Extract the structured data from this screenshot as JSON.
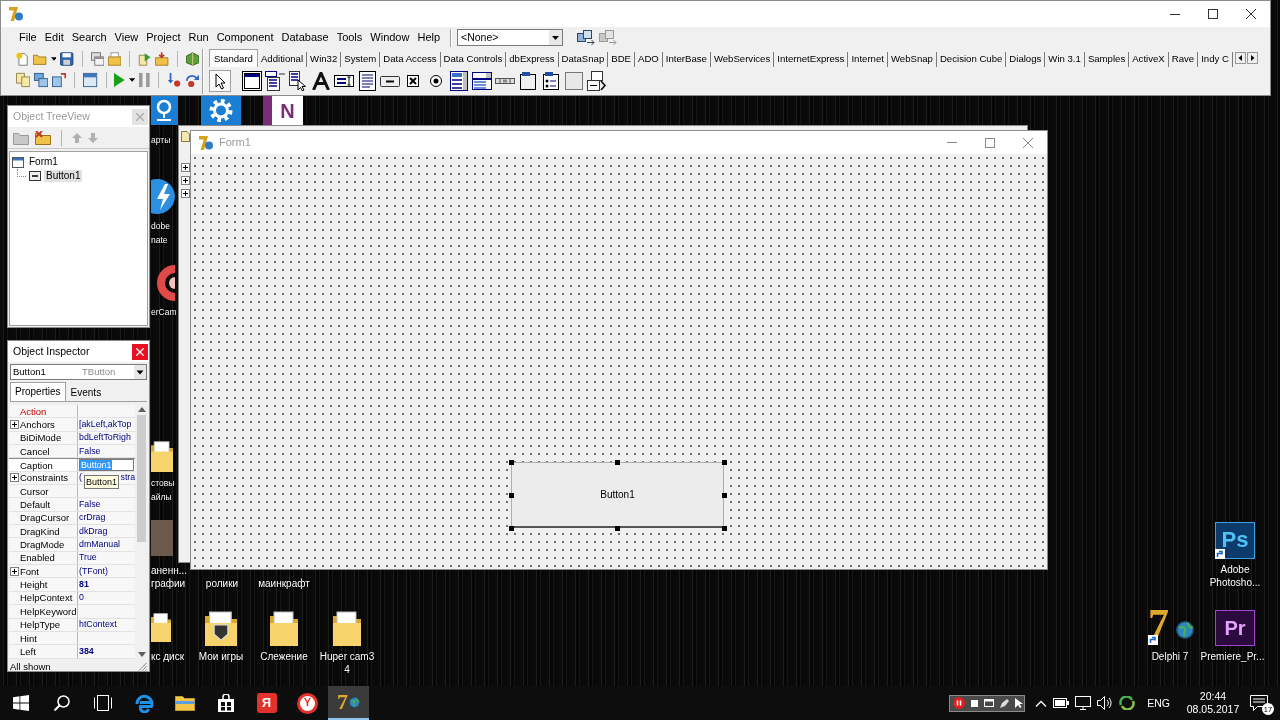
{
  "ide": {
    "menu": [
      "File",
      "Edit",
      "Search",
      "View",
      "Project",
      "Run",
      "Component",
      "Database",
      "Tools",
      "Window",
      "Help"
    ],
    "component_combo": "<None>",
    "palette_tabs": [
      {
        "label": "Standard",
        "selected": true
      },
      {
        "label": "Additional",
        "selected": false
      },
      {
        "label": "Win32",
        "selected": false
      },
      {
        "label": "System",
        "selected": false
      },
      {
        "label": "Data Access",
        "selected": false
      },
      {
        "label": "Data Controls",
        "selected": false
      },
      {
        "label": "dbExpress",
        "selected": false
      },
      {
        "label": "DataSnap",
        "selected": false
      },
      {
        "label": "BDE",
        "selected": false
      },
      {
        "label": "ADO",
        "selected": false
      },
      {
        "label": "InterBase",
        "selected": false
      },
      {
        "label": "WebServices",
        "selected": false
      },
      {
        "label": "InternetExpress",
        "selected": false
      },
      {
        "label": "Internet",
        "selected": false
      },
      {
        "label": "WebSnap",
        "selected": false
      },
      {
        "label": "Decision Cube",
        "selected": false
      },
      {
        "label": "Dialogs",
        "selected": false
      },
      {
        "label": "Win 3.1",
        "selected": false
      },
      {
        "label": "Samples",
        "selected": false
      },
      {
        "label": "ActiveX",
        "selected": false
      },
      {
        "label": "Rave",
        "selected": false
      },
      {
        "label": "Indy C",
        "selected": false
      }
    ]
  },
  "tree_view": {
    "title": "Object TreeView",
    "nodes": [
      {
        "kind": "form",
        "label": "Form1",
        "selected": false,
        "children": [
          {
            "kind": "button",
            "label": "Button1",
            "selected": true
          }
        ]
      }
    ]
  },
  "object_inspector": {
    "title": "Object Inspector",
    "object_name": "Button1",
    "object_type": "TButton",
    "tabs": [
      {
        "label": "Properties",
        "selected": true
      },
      {
        "label": "Events",
        "selected": false
      }
    ],
    "properties": [
      {
        "name": "Action",
        "reference": true,
        "expandable": false,
        "selected": false
      },
      {
        "name": "Anchors",
        "value": "[akLeft,akTop",
        "reference": false,
        "expandable": true,
        "modified": false,
        "selected": false
      },
      {
        "name": "BiDiMode",
        "value": "bdLeftToRigh",
        "reference": false,
        "expandable": false,
        "modified": false,
        "selected": false
      },
      {
        "name": "Cancel",
        "value": "False",
        "reference": false,
        "expandable": false,
        "modified": false,
        "selected": false
      },
      {
        "name": "Caption",
        "value": "Button1",
        "reference": false,
        "expandable": false,
        "modified": false,
        "selected": true
      },
      {
        "name": "Constraints",
        "value_parts": [
          "(",
          "stra"
        ],
        "reference": false,
        "expandable": true,
        "modified": false,
        "selected": false
      },
      {
        "name": "Cursor",
        "reference": false,
        "expandable": false,
        "selected": false
      },
      {
        "name": "Default",
        "value": "False",
        "reference": false,
        "expandable": false,
        "modified": false,
        "selected": false
      },
      {
        "name": "DragCursor",
        "value": "crDrag",
        "reference": false,
        "expandable": false,
        "modified": false,
        "selected": false
      },
      {
        "name": "DragKind",
        "value": "dkDrag",
        "reference": false,
        "expandable": false,
        "modified": false,
        "selected": false
      },
      {
        "name": "DragMode",
        "value": "dmManual",
        "reference": false,
        "expandable": false,
        "modified": false,
        "selected": false
      },
      {
        "name": "Enabled",
        "value": "True",
        "reference": false,
        "expandable": false,
        "modified": false,
        "selected": false
      },
      {
        "name": "Font",
        "value": "(TFont)",
        "reference": false,
        "expandable": true,
        "modified": false,
        "selected": false
      },
      {
        "name": "Height",
        "value": "81",
        "reference": false,
        "expandable": false,
        "modified": true,
        "selected": false
      },
      {
        "name": "HelpContext",
        "value": "0",
        "reference": false,
        "expandable": false,
        "modified": false,
        "selected": false
      },
      {
        "name": "HelpKeyword",
        "reference": false,
        "expandable": false,
        "selected": false
      },
      {
        "name": "HelpType",
        "value": "htContext",
        "reference": false,
        "expandable": false,
        "modified": false,
        "selected": false
      },
      {
        "name": "Hint",
        "reference": false,
        "expandable": false,
        "selected": false
      },
      {
        "name": "Left",
        "value": "384",
        "reference": false,
        "expandable": false,
        "modified": true,
        "selected": false
      }
    ],
    "tooltip": "Button1",
    "status": "All shown"
  },
  "form": {
    "title": "Form1",
    "button": {
      "caption": "Button1",
      "selected": true
    }
  },
  "desktop_icons": [
    {
      "kind": "maps",
      "shortcut": false,
      "lines": [
        "арты"
      ]
    },
    {
      "kind": "settings",
      "shortcut": false
    },
    {
      "kind": "letter_tile",
      "glyph": "N",
      "shortcut": false
    },
    {
      "kind": "lightning",
      "shortcut": false,
      "lines": [
        "dobe",
        "nate"
      ]
    },
    {
      "kind": "ring",
      "shortcut": false,
      "lines": [
        "erCam"
      ]
    },
    {
      "kind": "folder",
      "shortcut": false,
      "lines": [
        "стовы",
        "айлы"
      ]
    },
    {
      "kind": "photo",
      "shortcut": false,
      "lines": [
        "аненн...",
        "графии"
      ]
    },
    {
      "kind": "hidden",
      "lines": [
        "ролики"
      ]
    },
    {
      "kind": "hidden",
      "lines": [
        "маинкрафт"
      ]
    },
    {
      "kind": "folder",
      "shortcut": false,
      "lines": [
        "кс диск"
      ]
    },
    {
      "kind": "emblem_folder",
      "shortcut": false,
      "lines": [
        "Мои игры"
      ]
    },
    {
      "kind": "folder",
      "shortcut": false,
      "lines": [
        "Слежение"
      ]
    },
    {
      "kind": "folder",
      "shortcut": false,
      "lines": [
        "Huper cam3",
        "4"
      ]
    },
    {
      "kind": "letter_tile",
      "glyph": "Ps",
      "shortcut": true,
      "lines": [
        "Adobe",
        "Photosho..."
      ]
    },
    {
      "kind": "delphi",
      "glyph": "7",
      "shortcut": true,
      "lines": [
        "Delphi 7"
      ]
    },
    {
      "kind": "letter_tile",
      "glyph": "Pr",
      "shortcut": false,
      "lines": [
        "Premiere_Pr..."
      ]
    }
  ],
  "taskbar": {
    "apps": [
      {
        "kind": "start",
        "active": false
      },
      {
        "kind": "search",
        "active": false
      },
      {
        "kind": "task_view",
        "active": false
      },
      {
        "kind": "browser",
        "active": false
      },
      {
        "kind": "explorer",
        "active": false
      },
      {
        "kind": "store",
        "active": false
      },
      {
        "kind": "letter_tile",
        "glyph": "Я",
        "active": false
      },
      {
        "kind": "letter_circle",
        "glyph": "Y",
        "active": false
      },
      {
        "kind": "delphi",
        "glyph": "7",
        "active": true
      }
    ],
    "language": "ENG",
    "time": "20:44",
    "date": "08.05.2017",
    "notification_count": "17"
  }
}
